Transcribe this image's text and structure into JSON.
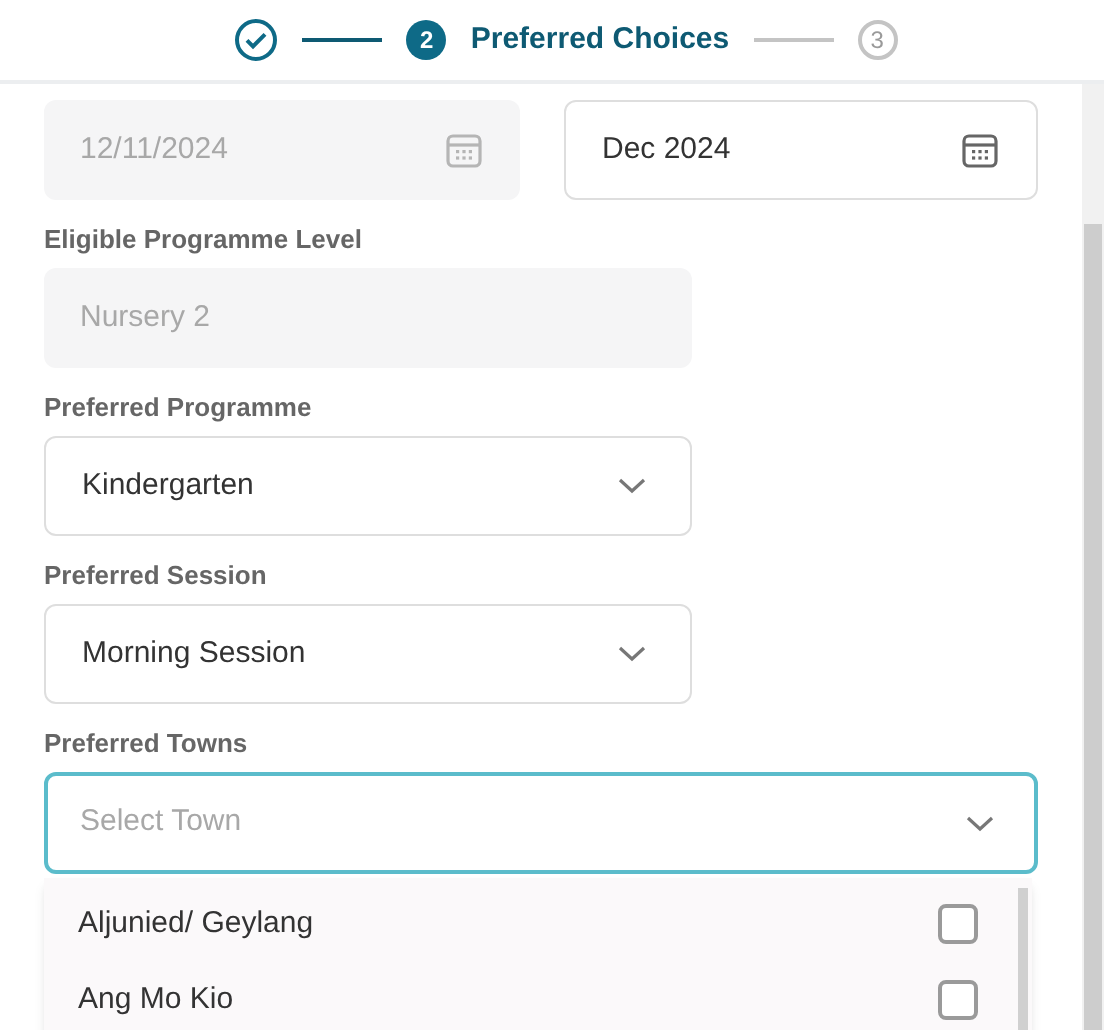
{
  "stepper": [
    {
      "kind": "done"
    },
    {
      "kind": "current",
      "number": "2",
      "label": "Preferred Choices"
    },
    {
      "kind": "upcoming",
      "number": "3"
    }
  ],
  "dates": [
    {
      "value": "12/11/2024",
      "disabled": true
    },
    {
      "value": "Dec 2024",
      "disabled": false
    }
  ],
  "fields": [
    {
      "label": "Eligible Programme Level",
      "kind": "readonly",
      "value": "Nursery 2"
    },
    {
      "label": "Preferred Programme",
      "kind": "select",
      "value": "Kindergarten"
    },
    {
      "label": "Preferred Session",
      "kind": "select",
      "value": "Morning Session"
    }
  ],
  "towns": {
    "label": "Preferred Towns",
    "placeholder": "Select Town",
    "focused": true,
    "options": [
      {
        "label": "Aljunied/ Geylang",
        "checked": false
      },
      {
        "label": "Ang Mo Kio",
        "checked": false
      }
    ]
  }
}
